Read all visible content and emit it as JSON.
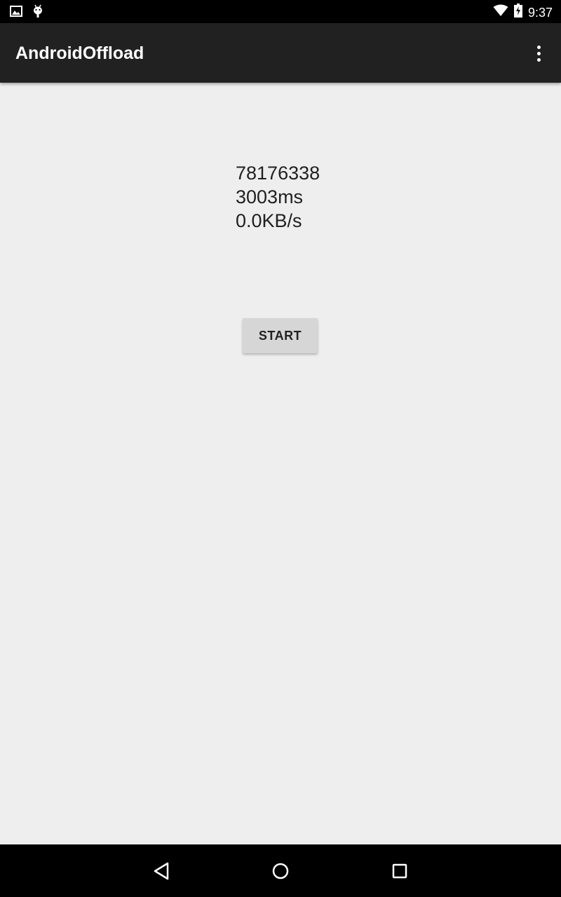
{
  "status_bar": {
    "time": "9:37",
    "left_icons": [
      "image-icon",
      "android-debug-icon"
    ],
    "right_icons": [
      "wifi-icon",
      "battery-charging-icon"
    ]
  },
  "app_bar": {
    "title": "AndroidOffload",
    "overflow_icon": "more-vert-icon"
  },
  "readout": {
    "value": "78176338",
    "duration": "3003ms",
    "speed": "0.0KB/s"
  },
  "start_button": {
    "label": "START"
  },
  "nav_bar": {
    "buttons": [
      "back-icon",
      "home-icon",
      "recents-icon"
    ]
  },
  "colors": {
    "status_bar": "#000000",
    "app_bar": "#212121",
    "background": "#eeeeee",
    "button": "#d6d6d6",
    "text": "#212121"
  }
}
